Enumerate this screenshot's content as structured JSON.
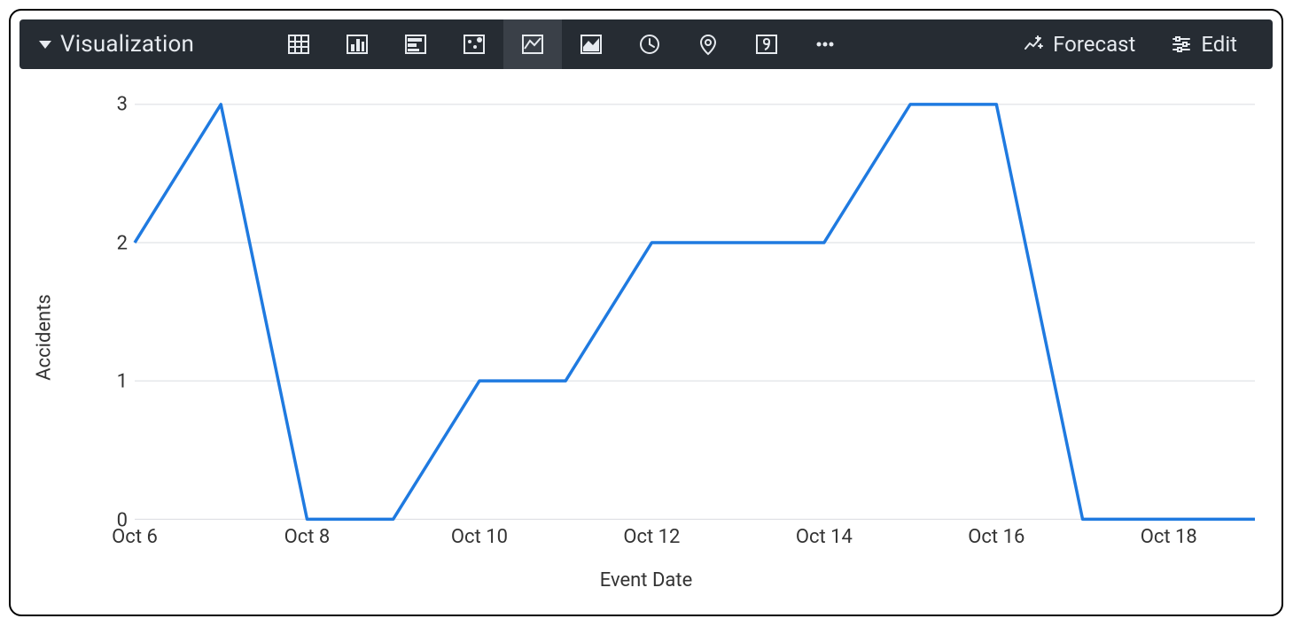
{
  "toolbar": {
    "title": "Visualization",
    "icons": [
      "table-icon",
      "column-chart-icon",
      "bar-chart-icon",
      "scatter-chart-icon",
      "line-chart-icon",
      "area-chart-icon",
      "timewrap-icon",
      "map-pin-icon",
      "single-value-icon",
      "more-icon"
    ],
    "active_icon_index": 4,
    "forecast_label": "Forecast",
    "edit_label": "Edit"
  },
  "chart_data": {
    "type": "line",
    "xlabel": "Event Date",
    "ylabel": "Accidents",
    "ylim": [
      0,
      3
    ],
    "y_ticks": [
      0,
      1,
      2,
      3
    ],
    "categories": [
      "Oct 6",
      "Oct 7",
      "Oct 8",
      "Oct 9",
      "Oct 10",
      "Oct 11",
      "Oct 12",
      "Oct 13",
      "Oct 14",
      "Oct 15",
      "Oct 16",
      "Oct 17",
      "Oct 18",
      "Oct 19"
    ],
    "x_tick_labels": [
      "Oct 6",
      "Oct 8",
      "Oct 10",
      "Oct 12",
      "Oct 14",
      "Oct 16",
      "Oct 18"
    ],
    "x_tick_indices": [
      0,
      2,
      4,
      6,
      8,
      10,
      12
    ],
    "values": [
      2,
      3,
      0,
      0,
      1,
      1,
      2,
      2,
      2,
      3,
      3,
      0,
      0,
      0
    ],
    "line_color": "#1f7ae0"
  }
}
